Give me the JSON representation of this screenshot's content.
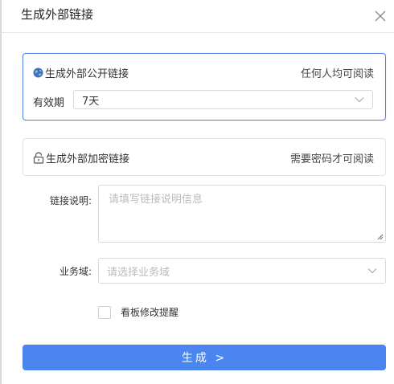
{
  "dialog": {
    "title": "生成外部链接"
  },
  "public_link": {
    "label": "生成外部公开链接",
    "hint": "任何人均可阅读",
    "validity_label": "有效期",
    "validity_value": "7天"
  },
  "encrypted_link": {
    "label": "生成外部加密链接",
    "hint": "需要密码才可阅读"
  },
  "form": {
    "description_label": "链接说明:",
    "description_placeholder": "请填写链接说明信息",
    "domain_label": "业务域:",
    "domain_placeholder": "请选择业务域"
  },
  "board_reminder": {
    "label": "看板修改提醒",
    "checked": false
  },
  "submit": {
    "label": "生成 >"
  },
  "colors": {
    "accent": "#4b86f0",
    "active_border": "#4f7fe8"
  },
  "icons": [
    "close-icon",
    "globe-icon",
    "lock-icon",
    "chevron-down-icon"
  ]
}
